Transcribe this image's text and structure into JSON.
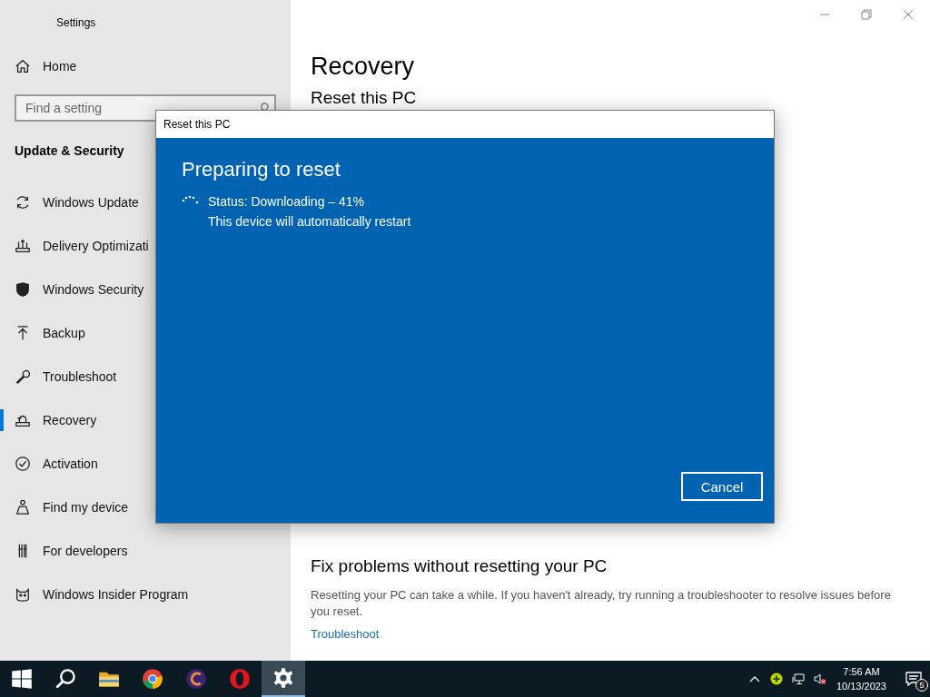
{
  "window": {
    "title": "Settings"
  },
  "sidebar": {
    "home": "Home",
    "search": {
      "placeholder": "Find a setting"
    },
    "section": "Update & Security",
    "items": [
      {
        "label": "Windows Update",
        "kind": "update",
        "selected": false
      },
      {
        "label": "Delivery Optimizati",
        "kind": "delivery",
        "selected": false
      },
      {
        "label": "Windows Security",
        "kind": "shield",
        "selected": false
      },
      {
        "label": "Backup",
        "kind": "backup",
        "selected": false
      },
      {
        "label": "Troubleshoot",
        "kind": "wrench",
        "selected": false
      },
      {
        "label": "Recovery",
        "kind": "recovery",
        "selected": true
      },
      {
        "label": "Activation",
        "kind": "check",
        "selected": false
      },
      {
        "label": "Find my device",
        "kind": "person",
        "selected": false
      },
      {
        "label": "For developers",
        "kind": "dev",
        "selected": false
      },
      {
        "label": "Windows Insider Program",
        "kind": "insider",
        "selected": false
      }
    ]
  },
  "main": {
    "title": "Recovery",
    "section": "Reset this PC",
    "fix_title": "Fix problems without resetting your PC",
    "fix_text": "Resetting your PC can take a while. If you haven't already, try running a troubleshooter to resolve issues before you reset.",
    "fix_link": "Troubleshoot"
  },
  "dialog": {
    "title": "Reset this PC",
    "heading": "Preparing to reset",
    "status": "Status: Downloading – 41%",
    "note": "This device will automatically restart",
    "button": "Cancel"
  },
  "taskbar": {
    "apps": [
      {
        "kind": "start",
        "selected": false
      },
      {
        "kind": "search",
        "selected": false
      },
      {
        "kind": "folder",
        "selected": false
      },
      {
        "kind": "chrome",
        "selected": false
      },
      {
        "kind": "c-app",
        "selected": false
      },
      {
        "kind": "opera",
        "selected": false
      },
      {
        "kind": "gear",
        "selected": true
      }
    ],
    "time": "7:56 AM",
    "date": "10/13/2023",
    "notifications": "5"
  }
}
